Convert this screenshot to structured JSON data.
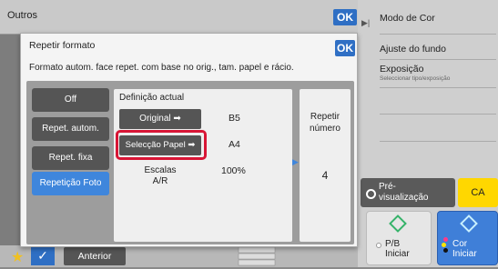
{
  "top_bar": {
    "title": "Outros",
    "ok_label": "OK"
  },
  "right_panel": {
    "items": [
      {
        "label": "Modo de Cor",
        "sub": ""
      },
      {
        "label": "Ajuste do fundo",
        "sub": ""
      },
      {
        "label": "Exposição",
        "sub": "Seleccionar tipo/exposição"
      }
    ],
    "preview_label": "Pré-\nvisualização",
    "ca_label": "CA",
    "start_bw_label": "P/B\nIniciar",
    "start_color_label": "Cor\nIniciar"
  },
  "bottom_bar": {
    "back_label": "Anterior"
  },
  "dialog": {
    "title": "Repetir formato",
    "ok_label": "OK",
    "description": "Formato autom. face repet. com base no orig., tam. papel e rácio.",
    "modes": [
      {
        "label": "Off",
        "active": false
      },
      {
        "label": "Repet. autom.",
        "active": false
      },
      {
        "label": "Repet. fixa",
        "active": false
      },
      {
        "label": "Repetição Foto",
        "active": true
      }
    ],
    "current_settings": {
      "title": "Definição actual",
      "original_label": "Original",
      "original_value": "B5",
      "paper_label": "Selecção Papel",
      "paper_value": "A4",
      "scale_label": "Escalas\nA/R",
      "scale_value": "100%"
    },
    "repeat": {
      "label": "Repetir\nnúmero",
      "value": "4"
    }
  },
  "colors": {
    "accent": "#2f6fc4",
    "active_mode": "#3f86dc",
    "highlight": "#d81535",
    "ca": "#ffd700"
  }
}
